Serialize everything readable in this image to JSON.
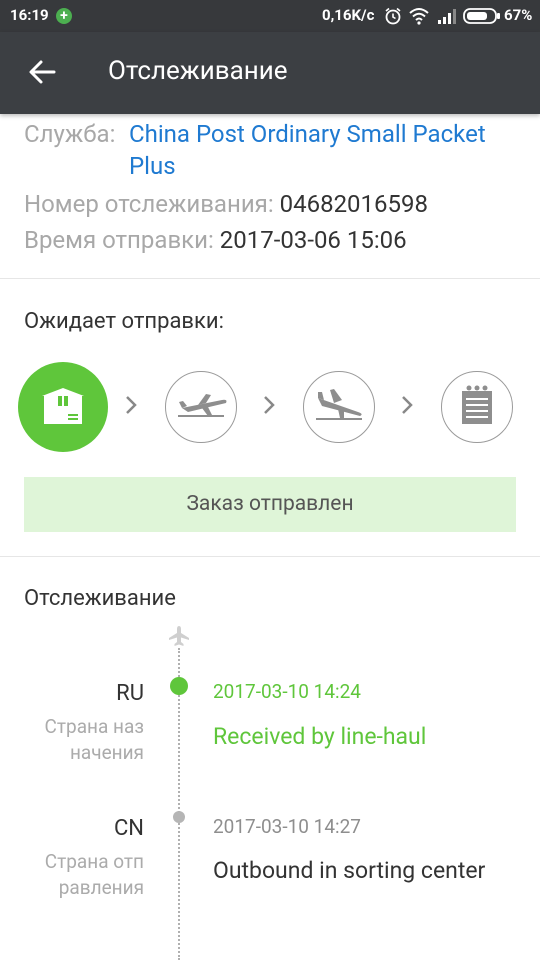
{
  "status_bar": {
    "time": "16:19",
    "net_speed": "0,16K/c",
    "battery": "67%"
  },
  "appbar": {
    "title": "Отслеживание"
  },
  "info": {
    "service_label": "Служба:",
    "service_value": "China Post Ordinary Small Packet Plus",
    "tracking_label": "Номер отслеживания:",
    "tracking_value": "04682016598",
    "sent_label": "Время отправки:",
    "sent_value": "2017-03-06 15:06"
  },
  "progress": {
    "heading": "Ожидает отправки:",
    "steps": [
      "package-icon",
      "plane-takeoff-icon",
      "plane-landing-icon",
      "delivered-board-icon"
    ],
    "active_step": 0,
    "banner": "Заказ отправлен"
  },
  "tracking": {
    "title": "Отслеживание",
    "events": [
      {
        "code": "RU",
        "country": "Страна наз начения",
        "time": "2017-03-10 14:24",
        "status": "Received by line-haul",
        "highlight": true
      },
      {
        "code": "CN",
        "country": "Страна отп равления",
        "time": "2017-03-10 14:27",
        "status": "Outbound in sorting center",
        "highlight": false
      }
    ]
  },
  "colors": {
    "accent_green": "#5fc63b",
    "link_blue": "#1f7ad1",
    "appbar": "#3c3f43",
    "banner_bg": "#dff5d8"
  }
}
